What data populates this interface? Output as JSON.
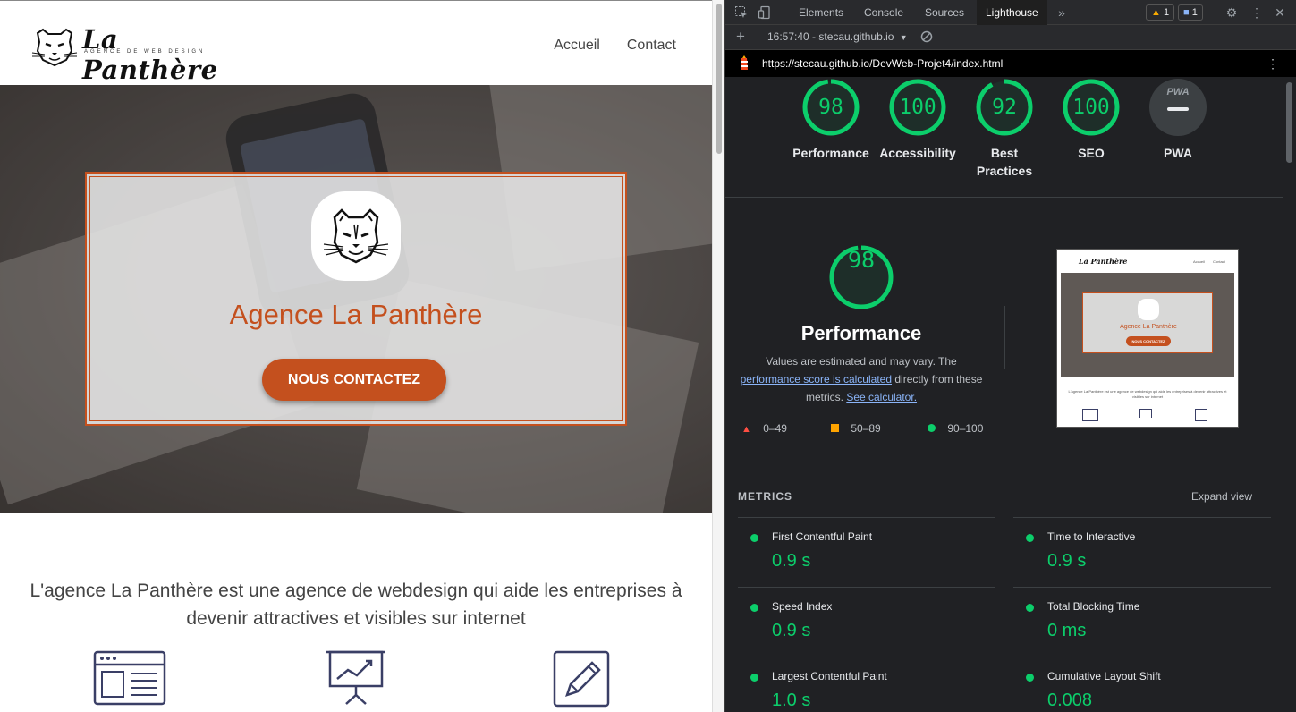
{
  "site": {
    "logo": {
      "name": "La Panthère",
      "tagline": "AGENCE DE WEB DESIGN"
    },
    "nav": [
      {
        "label": "Accueil"
      },
      {
        "label": "Contact"
      }
    ],
    "hero": {
      "title": "Agence La Panthère",
      "cta_label": "NOUS CONTACTEZ"
    },
    "intro": "L'agence La Panthère est une agence de webdesign qui aide les entreprises à devenir attractives et visibles sur internet",
    "services": [
      {
        "icon": "webpage-layout-icon"
      },
      {
        "icon": "presentation-chart-icon"
      },
      {
        "icon": "pencil-edit-icon"
      }
    ],
    "colors": {
      "accent": "#c4501e",
      "text": "#444444",
      "icon": "#3a3f66"
    }
  },
  "devtools": {
    "tabs": [
      {
        "label": "Elements"
      },
      {
        "label": "Console"
      },
      {
        "label": "Sources"
      },
      {
        "label": "Lighthouse"
      }
    ],
    "active_tab": "Lighthouse",
    "more_tabs_icon": "chevron-double-right-icon",
    "warnings_count": "1",
    "messages_count": "1",
    "report_select": "16:57:40 - stecau.github.io",
    "url": "https://stecau.github.io/DevWeb-Projet4/index.html",
    "categories": [
      {
        "label": "Performance",
        "score": "98"
      },
      {
        "label": "Accessibility",
        "score": "100"
      },
      {
        "label": "Best Practices",
        "score": "92"
      },
      {
        "label": "SEO",
        "score": "100"
      },
      {
        "label": "PWA",
        "score": ""
      }
    ],
    "pwa_badge": "PWA",
    "performance": {
      "score": "98",
      "title": "Performance",
      "desc_start": "Values are estimated and may vary. The",
      "desc_link1": "performance score is calculated",
      "desc_mid": "directly from these metrics.",
      "desc_link2": "See calculator.",
      "legend": [
        {
          "label": "0–49",
          "color": "#ff4e42"
        },
        {
          "label": "50–89",
          "color": "#ffa400"
        },
        {
          "label": "90–100",
          "color": "#0cce6b"
        }
      ],
      "thumb": {
        "logo": "La Panthère",
        "nav1": "Accueil",
        "nav2": "Contact",
        "title": "Agence La Panthère",
        "cta": "NOUS CONTACTEZ",
        "intro": "L'agence La Panthère est une agence de webdesign qui aide les entreprises à devenir attractives et visibles sur internet"
      }
    },
    "metrics": {
      "title": "METRICS",
      "expand_label": "Expand view",
      "items": [
        {
          "name": "First Contentful Paint",
          "value": "0.9 s"
        },
        {
          "name": "Time to Interactive",
          "value": "0.9 s"
        },
        {
          "name": "Speed Index",
          "value": "0.9 s"
        },
        {
          "name": "Total Blocking Time",
          "value": "0 ms"
        },
        {
          "name": "Largest Contentful Paint",
          "value": "1.0 s"
        },
        {
          "name": "Cumulative Layout Shift",
          "value": "0.008"
        }
      ]
    },
    "colors": {
      "pass": "#0cce6b",
      "link": "#8ab4f8",
      "bg": "#202124"
    }
  }
}
